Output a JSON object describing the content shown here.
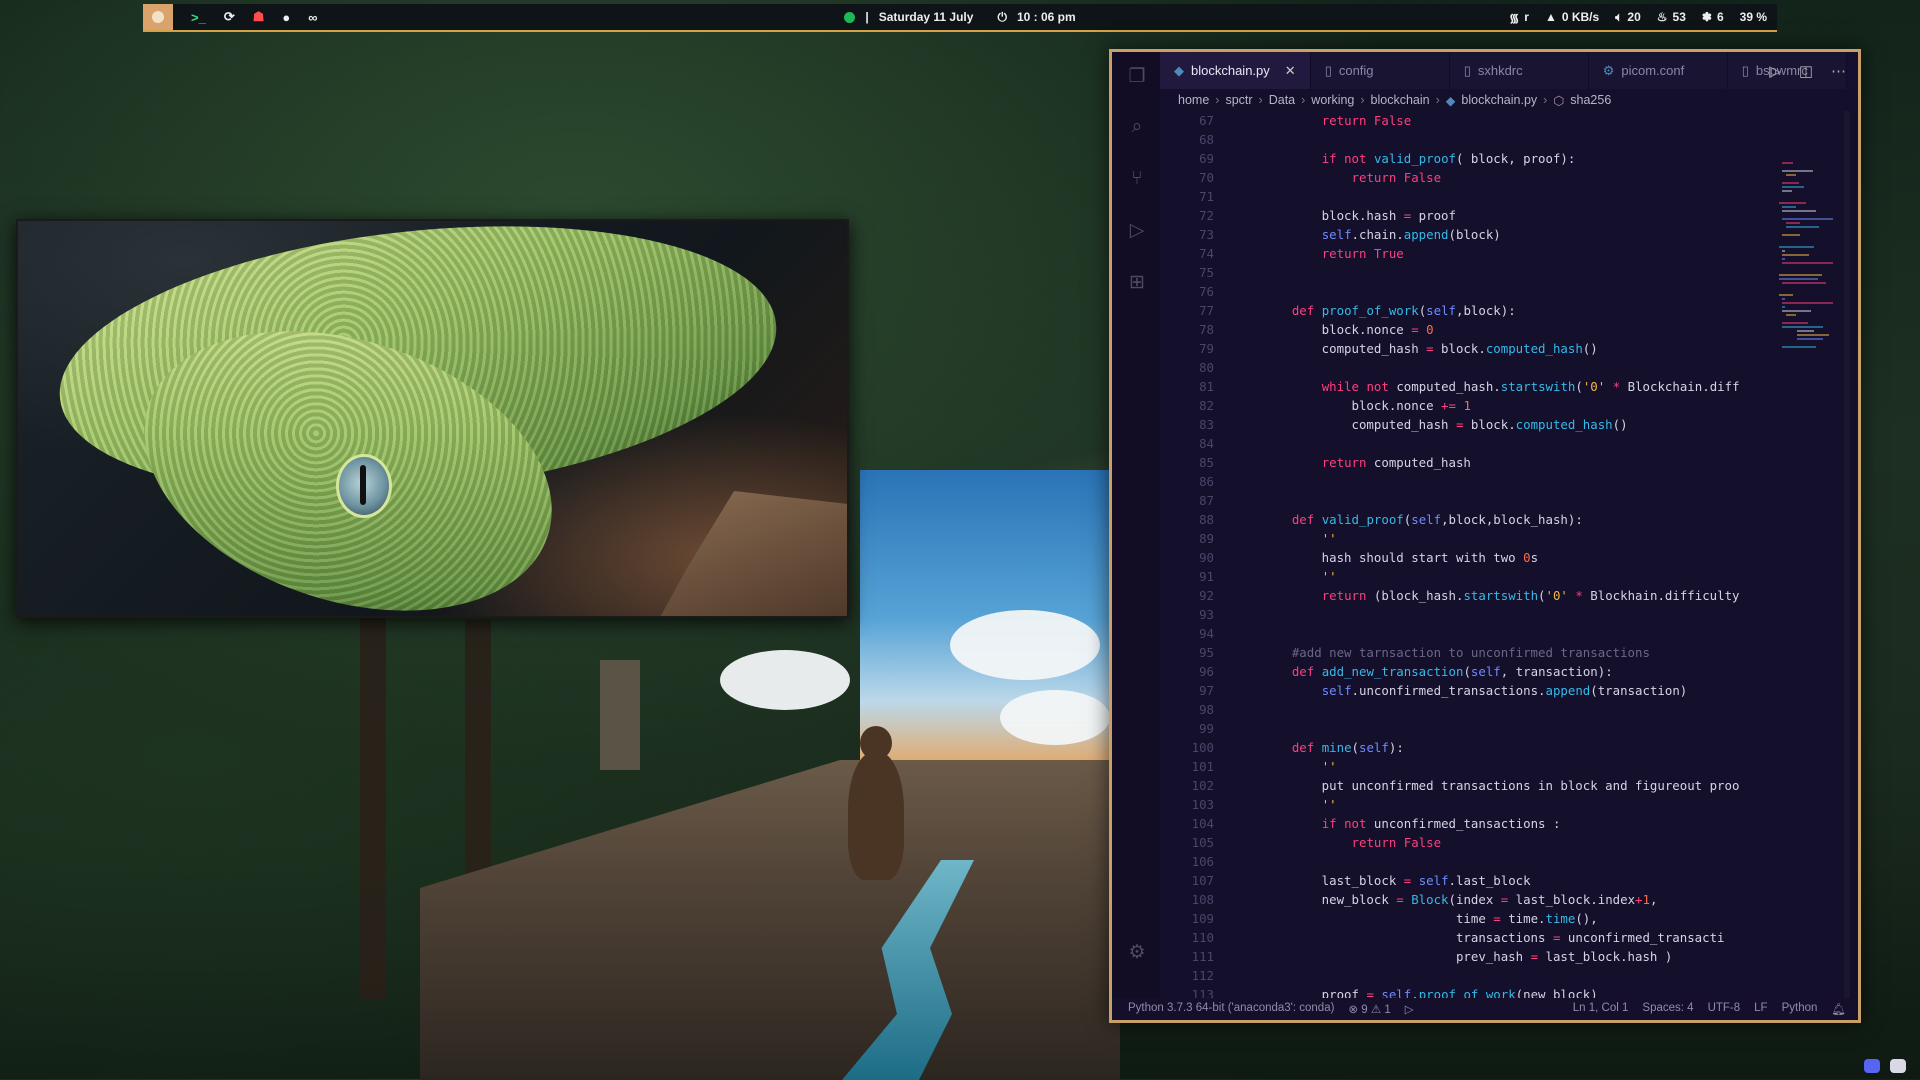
{
  "topbar": {
    "apps": [
      "terminal",
      "refresh",
      "brave",
      "github",
      "infinity"
    ],
    "date": "Saturday 11 July",
    "time": "10 : 06 pm",
    "wifi": "r",
    "net_speed": "0 KB/s",
    "volume": "20",
    "cpu_temp": "53",
    "cpu_load": "6",
    "battery": "39 %"
  },
  "editor": {
    "tabs": [
      {
        "label": "blockchain.py",
        "active": true
      },
      {
        "label": "config"
      },
      {
        "label": "sxhkdrc"
      },
      {
        "label": "picom.conf"
      },
      {
        "label": "bspwmrc"
      }
    ],
    "breadcrumb": [
      "home",
      "spctr",
      "Data",
      "working",
      "blockchain",
      "blockchain.py",
      "sha256"
    ],
    "code": [
      {
        "n": "67",
        "t": "        return False"
      },
      {
        "n": "68",
        "t": ""
      },
      {
        "n": "69",
        "t": "        if not valid_proof( block, proof):"
      },
      {
        "n": "70",
        "t": "            return False"
      },
      {
        "n": "71",
        "t": ""
      },
      {
        "n": "72",
        "t": "        block.hash = proof"
      },
      {
        "n": "73",
        "t": "        self.chain.append(block)"
      },
      {
        "n": "74",
        "t": "        return True"
      },
      {
        "n": "75",
        "t": ""
      },
      {
        "n": "76",
        "t": ""
      },
      {
        "n": "77",
        "t": "    def proof_of_work(self,block):"
      },
      {
        "n": "78",
        "t": "        block.nonce = 0"
      },
      {
        "n": "79",
        "t": "        computed_hash = block.computed_hash()"
      },
      {
        "n": "80",
        "t": ""
      },
      {
        "n": "81",
        "t": "        while not computed_hash.startswith('0' * Blockchain.diff"
      },
      {
        "n": "82",
        "t": "            block.nonce += 1"
      },
      {
        "n": "83",
        "t": "            computed_hash = block.computed_hash()"
      },
      {
        "n": "84",
        "t": ""
      },
      {
        "n": "85",
        "t": "        return computed_hash"
      },
      {
        "n": "86",
        "t": ""
      },
      {
        "n": "87",
        "t": ""
      },
      {
        "n": "88",
        "t": "    def valid_proof(self,block,block_hash):"
      },
      {
        "n": "89",
        "t": "        '''"
      },
      {
        "n": "90",
        "t": "        hash should start with two 0's"
      },
      {
        "n": "91",
        "t": "        '''"
      },
      {
        "n": "92",
        "t": "        return (block_hash.startswith('0' * Blockhain.difficulty"
      },
      {
        "n": "93",
        "t": ""
      },
      {
        "n": "94",
        "t": ""
      },
      {
        "n": "95",
        "t": "    #add new tarnsaction to unconfirmed transactions"
      },
      {
        "n": "96",
        "t": "    def add_new_transaction(self, transaction):"
      },
      {
        "n": "97",
        "t": "        self.unconfirmed_transactions.append(transaction)"
      },
      {
        "n": "98",
        "t": ""
      },
      {
        "n": "99",
        "t": ""
      },
      {
        "n": "100",
        "t": "    def mine(self):"
      },
      {
        "n": "101",
        "t": "        '''"
      },
      {
        "n": "102",
        "t": "        put unconfirmed transactions in block and figureout proo"
      },
      {
        "n": "103",
        "t": "        '''"
      },
      {
        "n": "104",
        "t": "        if not unconfirmed_tansactions :"
      },
      {
        "n": "105",
        "t": "            return False"
      },
      {
        "n": "106",
        "t": ""
      },
      {
        "n": "107",
        "t": "        last_block = self.last_block"
      },
      {
        "n": "108",
        "t": "        new_block = Block(index = last_block.index+1,"
      },
      {
        "n": "109",
        "t": "                          time = time.time(),"
      },
      {
        "n": "110",
        "t": "                          transactions = unconfirmed_transacti"
      },
      {
        "n": "111",
        "t": "                          prev_hash = last_block.hash )"
      },
      {
        "n": "112",
        "t": ""
      },
      {
        "n": "113",
        "t": "        proof = self.proof_of_work(new_block)"
      }
    ],
    "status": {
      "interpreter": "Python 3.7.3 64-bit ('anaconda3': conda)",
      "errors": "9",
      "warnings": "1",
      "position": "Ln 1, Col 1",
      "spaces": "Spaces: 4",
      "encoding": "UTF-8",
      "eol": "LF",
      "language": "Python"
    }
  },
  "colors": {
    "accent_border": "#c9a067",
    "topbar_accent": "#d4a246",
    "editor_bg": "#140f2a",
    "keyword": "#ff3f7f",
    "function": "#36b9e8",
    "string": "#f3b845"
  }
}
